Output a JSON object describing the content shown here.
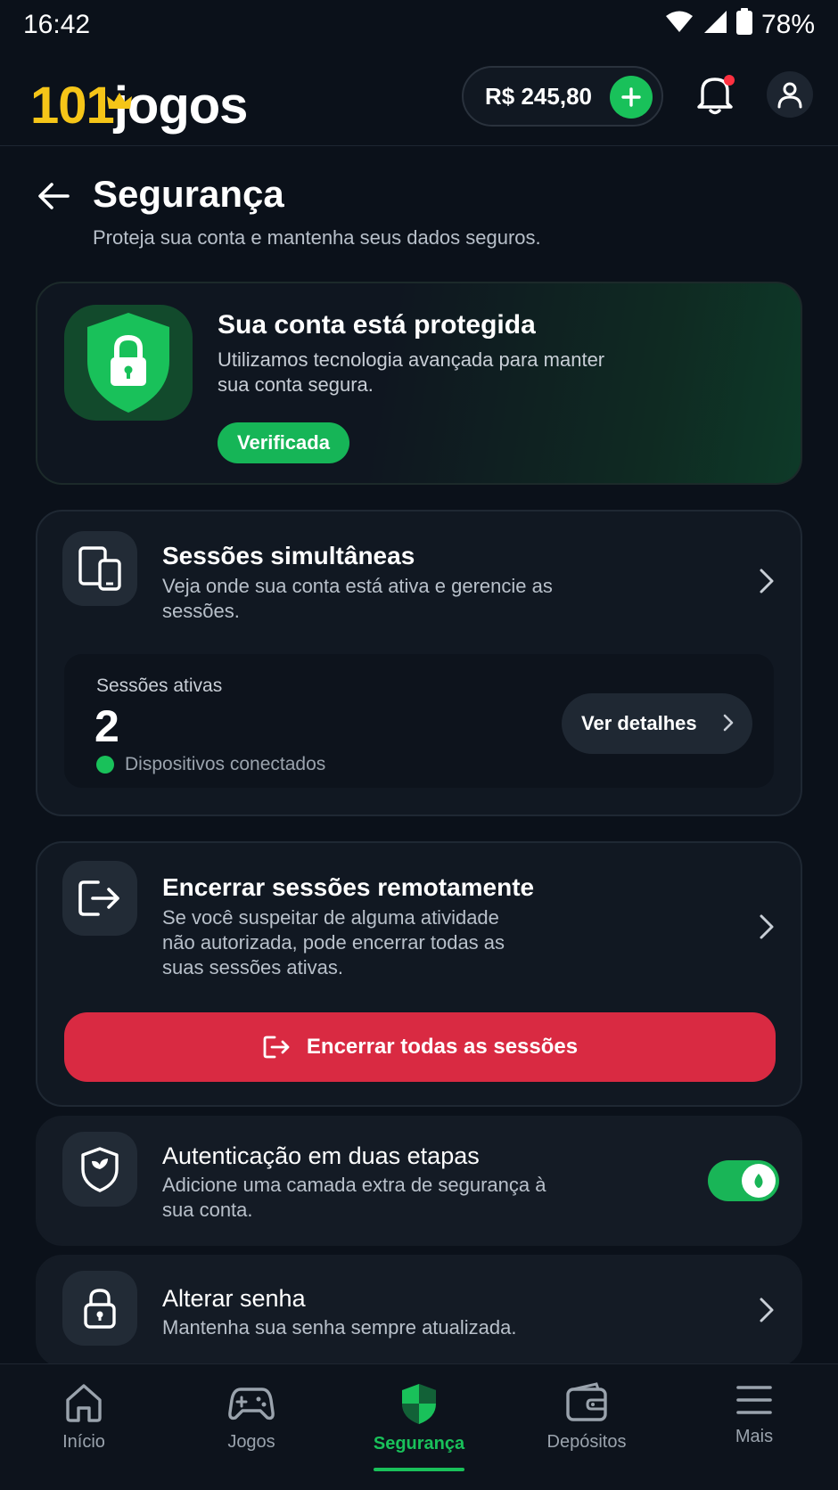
{
  "status": {
    "time": "16:42",
    "battery": "78%"
  },
  "header": {
    "logo_number": "101",
    "logo_text": "jogos",
    "balance": "R$ 245,80"
  },
  "page": {
    "title": "Segurança",
    "subtitle": "Proteja sua conta e mantenha seus dados seguros."
  },
  "hero": {
    "title": "Sua conta está protegida",
    "description": "Utilizamos tecnologia avançada para manter sua conta segura.",
    "badge": "Verificada"
  },
  "sessions": {
    "title": "Sessões simultâneas",
    "description": "Veja onde sua conta está ativa e gerencie as sessões.",
    "active_label": "Sessões ativas",
    "active_count": "2",
    "status_text": "Dispositivos conectados",
    "details_button": "Ver detalhes"
  },
  "remote": {
    "title": "Encerrar sessões remotamente",
    "description": "Se você suspeitar de alguma atividade não autorizada, pode encerrar todas as suas sessões ativas.",
    "button": "Encerrar todas as sessões"
  },
  "twofa": {
    "title": "Autenticação em duas etapas",
    "description": "Adicione uma camada extra de segurança à sua conta.",
    "enabled": true
  },
  "password": {
    "title": "Alterar senha",
    "description": "Mantenha sua senha sempre atualizada."
  },
  "nav": {
    "items": [
      {
        "label": "Início",
        "icon": "home-icon"
      },
      {
        "label": "Jogos",
        "icon": "gamepad-icon"
      },
      {
        "label": "Segurança",
        "icon": "shield-icon",
        "active": true
      },
      {
        "label": "Depósitos",
        "icon": "wallet-icon"
      },
      {
        "label": "Mais",
        "icon": "menu-icon"
      }
    ]
  },
  "colors": {
    "background": "#0b111a",
    "accent_green": "#19c15a",
    "danger": "#d92a42",
    "logo_yellow": "#f5c518"
  }
}
